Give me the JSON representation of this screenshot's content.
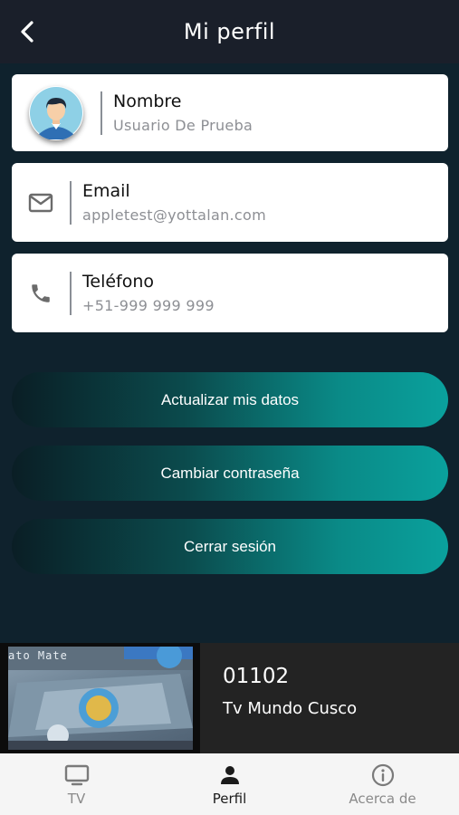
{
  "header": {
    "title": "Mi perfil",
    "back_icon": "chevron-left-icon"
  },
  "profile": {
    "name": {
      "label": "Nombre",
      "value": "Usuario De Prueba",
      "icon": "user-avatar"
    },
    "email": {
      "label": "Email",
      "value": "appletest@yottalan.com",
      "icon": "mail-icon"
    },
    "phone": {
      "label": "Teléfono",
      "value": "+51-999 999 999",
      "icon": "phone-icon"
    }
  },
  "actions": {
    "update": "Actualizar mis datos",
    "change_password": "Cambiar contraseña",
    "logout": "Cerrar sesión"
  },
  "now_playing": {
    "channel_number": "01102",
    "channel_name": "Tv Mundo Cusco",
    "thumb_text": "ato Mate"
  },
  "nav": {
    "items": [
      {
        "label": "TV",
        "icon": "tv-icon",
        "active": false
      },
      {
        "label": "Perfil",
        "icon": "person-icon",
        "active": true
      },
      {
        "label": "Acerca de",
        "icon": "info-icon",
        "active": false
      }
    ]
  },
  "colors": {
    "background": "#0f222d",
    "header": "#1a1f2a",
    "accent_teal": "#0aa19d"
  }
}
